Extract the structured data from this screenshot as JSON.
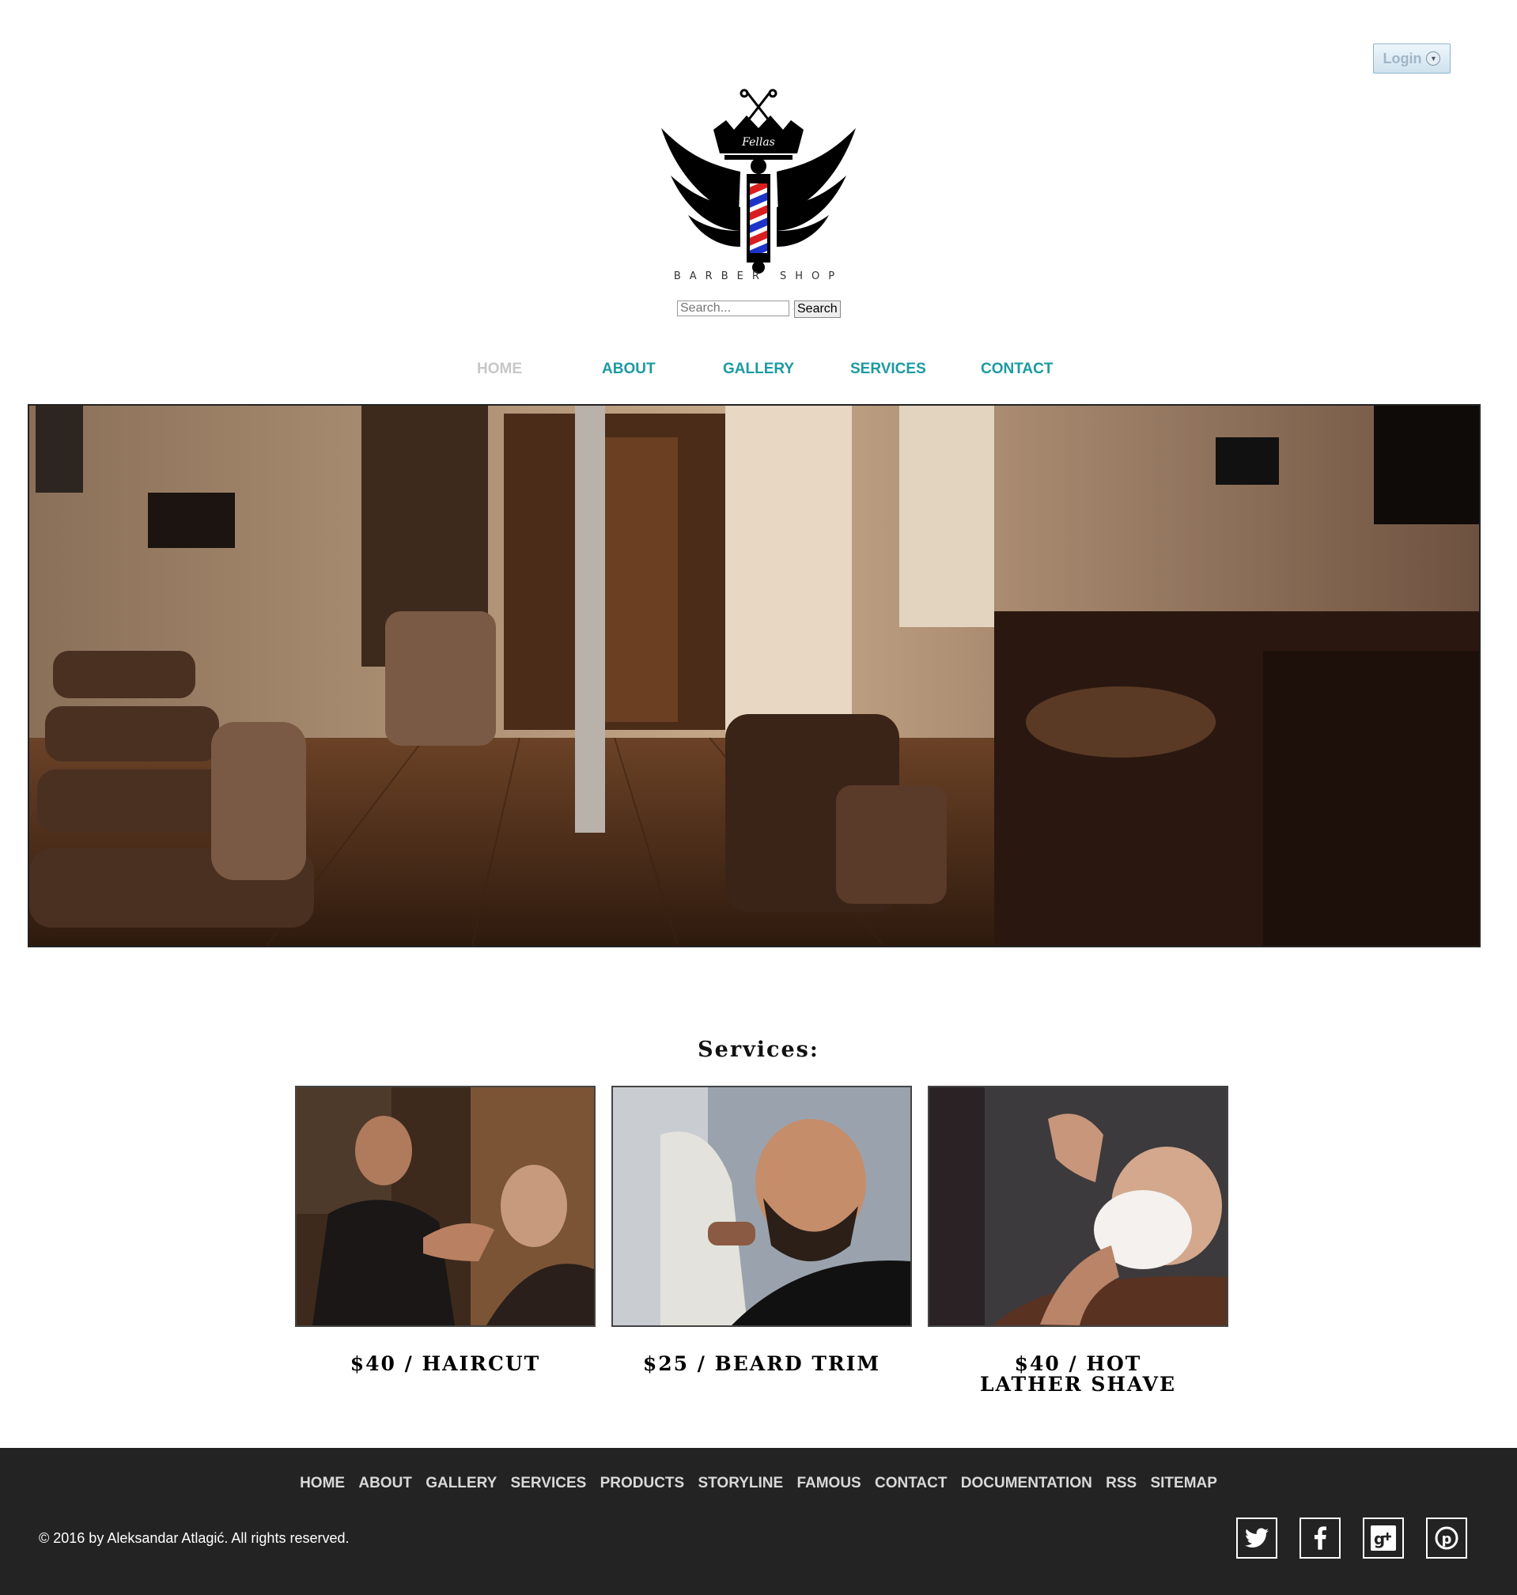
{
  "header": {
    "login_label": "Login",
    "logo_text": "BARBER SHOP",
    "logo_script": "Fellas"
  },
  "search": {
    "placeholder": "Search...",
    "button_label": "Search"
  },
  "nav": {
    "items": [
      "HOME",
      "ABOUT",
      "GALLERY",
      "SERVICES",
      "CONTACT"
    ],
    "active": "HOME"
  },
  "services": {
    "title": "Services:",
    "items": [
      {
        "label": "$40 / HAIRCUT"
      },
      {
        "label": "$25 / BEARD TRIM"
      },
      {
        "label": "$40 / HOT LATHER SHAVE"
      }
    ]
  },
  "footer": {
    "links": [
      "HOME",
      "ABOUT",
      "GALLERY",
      "SERVICES",
      "PRODUCTS",
      "STORYLINE",
      "FAMOUS",
      "CONTACT",
      "DOCUMENTATION",
      "RSS",
      "SITEMAP"
    ],
    "copyright": "© 2016 by Aleksandar Atlagić. All rights reserved.",
    "social": [
      "twitter-icon",
      "facebook-icon",
      "google-plus-icon",
      "pinterest-icon"
    ]
  },
  "colors": {
    "nav_link": "#1b9aa3",
    "nav_active": "#c7c7c7",
    "footer_bg": "#232323"
  }
}
